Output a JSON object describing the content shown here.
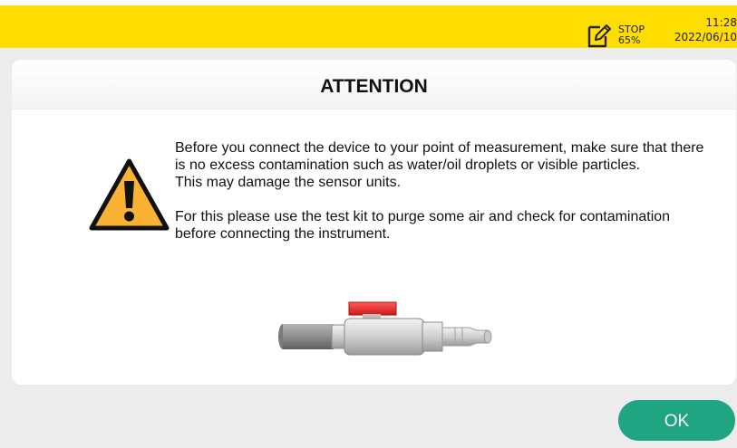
{
  "status_bar": {
    "mode": "STOP",
    "battery": "65%",
    "time": "11:28",
    "date": "2022/06/10",
    "icon": "edit-note-icon",
    "color": "#ffdd00"
  },
  "dialog": {
    "title": "ATTENTION",
    "warning_icon": "warning-triangle-icon",
    "warning_color": "#f9b233",
    "paragraphs": [
      "Before you connect the device to your point of measurement, make sure that there is no excess contamination such as water/oil droplets or visible particles.",
      "This may damage the sensor units.",
      "For this please use the test kit to purge some air and check for contamination before connecting the instrument."
    ],
    "image": "test-kit-valve-image"
  },
  "ok_button": {
    "label": "OK",
    "color": "#1fa582"
  }
}
